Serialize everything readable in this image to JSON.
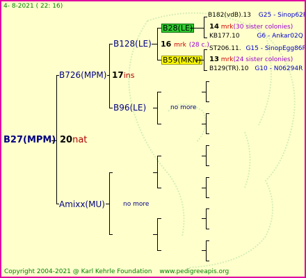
{
  "header": {
    "date": "4-  8-2021 ( 22: 16)"
  },
  "root": {
    "name": "B27(MPM)",
    "year": "20",
    "suffix": "nat"
  },
  "father": {
    "name": "B726(MPM)",
    "year": "17",
    "suffix": "ins"
  },
  "mother": {
    "name": "Amixx(MU)",
    "note": "no more"
  },
  "ff": {
    "name": "B128(LE)",
    "year": "16",
    "suffix": "mrk",
    "note": "(28 c.)"
  },
  "fm": {
    "name": "B96(LE)",
    "note": "no more"
  },
  "fff": {
    "name": "B28(LE)"
  },
  "ffm": {
    "name": "B59(MKN)"
  },
  "right": {
    "r1": {
      "id": "B182(vdB).13",
      "code": "G25 - Sinop62R"
    },
    "r2": {
      "year": "14",
      "mrk": "mrk",
      "note": "(30 sister colonies)"
    },
    "r3": {
      "id": "KB177.10",
      "code": "G6 - Ankar02Q"
    },
    "r4": {
      "id": "ST206.11.",
      "code": "G15 - SinopEgg86R"
    },
    "r5": {
      "year": "13",
      "mrk": "mrk",
      "note": "(24 sister colonies)"
    },
    "r6": {
      "id": "B129(TR).10",
      "code": "G10 - N06294R"
    }
  },
  "footer": {
    "copyright": "Copyright 2004-2021 @ Karl Kehrle Foundation",
    "url": "www.pedigreeapis.org"
  },
  "colors": {
    "border": "#e000a0",
    "background": "#ffffcc",
    "green": "#33cc33",
    "yellow": "#ffff00"
  }
}
